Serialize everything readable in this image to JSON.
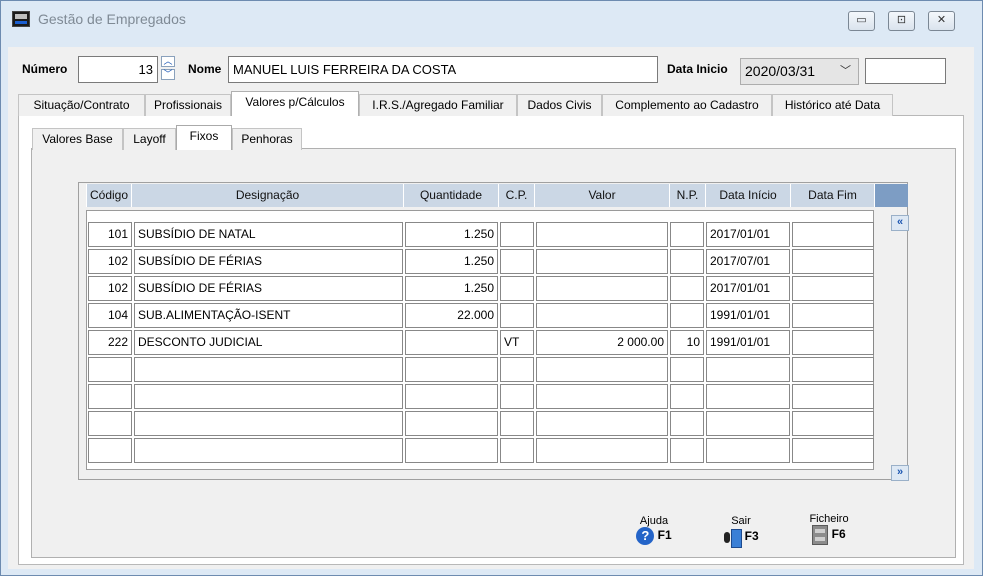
{
  "window": {
    "title": "Gestão de Empregados"
  },
  "header": {
    "numero_label": "Número",
    "numero_value": "13",
    "nome_label": "Nome",
    "nome_value": "MANUEL LUIS FERREIRA DA COSTA",
    "data_inicio_label": "Data Inicio",
    "data_inicio_value": "2020/03/31",
    "extra_value": ""
  },
  "tabs": [
    {
      "label": "Situação/Contrato"
    },
    {
      "label": "Profissionais"
    },
    {
      "label": "Valores p/Cálculos"
    },
    {
      "label": "I.R.S./Agregado Familiar"
    },
    {
      "label": "Dados Civis"
    },
    {
      "label": "Complemento ao Cadastro"
    },
    {
      "label": "Histórico até Data"
    }
  ],
  "subtabs": [
    {
      "label": "Valores Base"
    },
    {
      "label": "Layoff"
    },
    {
      "label": "Fixos"
    },
    {
      "label": "Penhoras"
    }
  ],
  "grid": {
    "columns": [
      "Código",
      "Designação",
      "Quantidade",
      "C.P.",
      "Valor",
      "N.P.",
      "Data Início",
      "Data Fim"
    ],
    "rows": [
      [
        "101",
        "SUBSÍDIO DE NATAL",
        "1.250",
        "",
        "",
        "",
        "2017/01/01",
        ""
      ],
      [
        "102",
        "SUBSÍDIO DE FÉRIAS",
        "1.250",
        "",
        "",
        "",
        "2017/07/01",
        ""
      ],
      [
        "102",
        "SUBSÍDIO DE FÉRIAS",
        "1.250",
        "",
        "",
        "",
        "2017/01/01",
        ""
      ],
      [
        "104",
        "SUB.ALIMENTAÇÃO-ISENT",
        "22.000",
        "",
        "",
        "",
        "1991/01/01",
        ""
      ],
      [
        "222",
        "DESCONTO JUDICIAL",
        "",
        "VT",
        "2 000.00",
        "10",
        "1991/01/01",
        ""
      ],
      [
        "",
        "",
        "",
        "",
        "",
        "",
        "",
        ""
      ],
      [
        "",
        "",
        "",
        "",
        "",
        "",
        "",
        ""
      ],
      [
        "",
        "",
        "",
        "",
        "",
        "",
        "",
        ""
      ],
      [
        "",
        "",
        "",
        "",
        "",
        "",
        "",
        ""
      ]
    ],
    "nav_up": "«",
    "nav_down": "»"
  },
  "footer": {
    "help_caption": "Ajuda",
    "help_key": "F1",
    "help_icon": "help-icon",
    "exit_caption": "Sair",
    "exit_key": "F3",
    "exit_icon": "exit-icon",
    "file_caption": "Ficheiro",
    "file_key": "F6",
    "file_icon": "file-cabinet-icon"
  },
  "colors": {
    "title_bg": "#dde9f5",
    "grid_header": "#cbd7e5",
    "accent": "#1b55b0"
  }
}
